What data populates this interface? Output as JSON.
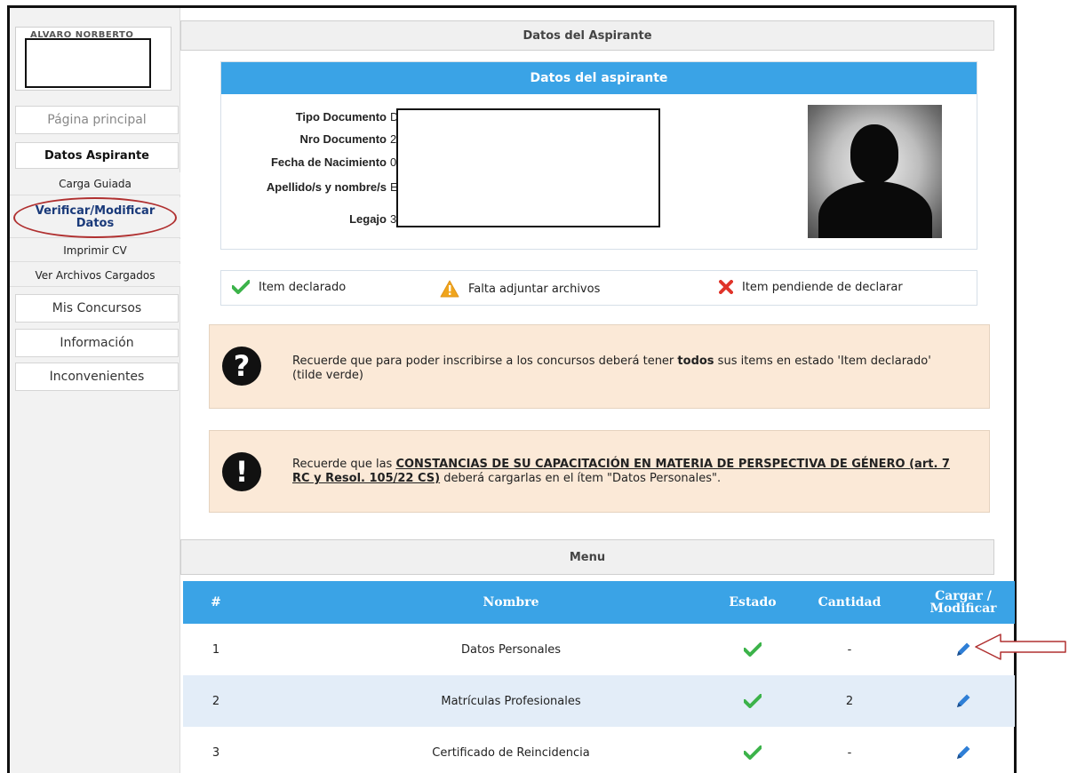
{
  "sidebar": {
    "user_box_text": "ALVARO NORBERTO",
    "nav": [
      {
        "label": "Página principal"
      },
      {
        "label": "Datos Aspirante"
      },
      {
        "label": "Carga Guiada"
      },
      {
        "label": "Verificar/Modificar Datos"
      },
      {
        "label": "Imprimir CV"
      },
      {
        "label": "Ver Archivos Cargados"
      },
      {
        "label": "Mis Concursos"
      },
      {
        "label": "Información"
      },
      {
        "label": "Inconvenientes"
      }
    ]
  },
  "header": {
    "title": "Datos del Aspirante"
  },
  "applicant": {
    "bar_title": "Datos del aspirante",
    "fields": [
      {
        "label": "Tipo Documento",
        "peek": "D"
      },
      {
        "label": "Nro Documento",
        "peek": "2"
      },
      {
        "label": "Fecha de Nacimiento",
        "peek": "0"
      },
      {
        "label": "Apellido/s y nombre/s",
        "peek": "E"
      },
      {
        "label": "Legajo",
        "peek": "3"
      }
    ]
  },
  "legend": {
    "declared": "Item declarado",
    "missing_files": "Falta adjuntar archivos",
    "pending": "Item pendiende de declarar",
    "colors": {
      "declared": "#3cb34a",
      "missing_files": "#f0a51c",
      "pending": "#e0342a"
    }
  },
  "notices": [
    {
      "icon": "?",
      "text_before": "Recuerde que para poder inscribirse a los concursos deberá tener ",
      "text_bold": "todos",
      "text_after": " sus items en estado 'Item declarado' (tilde verde)"
    },
    {
      "icon": "!",
      "text_before": "Recuerde que las ",
      "text_underlined": "CONSTANCIAS DE SU CAPACITACIÓN EN MATERIA DE PERSPECTIVA DE GÉNERO (art. 7 RC y Resol. 105/22 CS)",
      "text_after": " deberá cargarlas en el ítem \"Datos Personales\"."
    }
  ],
  "menu": {
    "title": "Menu",
    "columns": {
      "num": "#",
      "name": "Nombre",
      "status": "Estado",
      "count": "Cantidad",
      "edit_line1": "Cargar /",
      "edit_line2": "Modificar"
    },
    "rows": [
      {
        "num": "1",
        "name": "Datos Personales",
        "status": "declared",
        "count": "-"
      },
      {
        "num": "2",
        "name": "Matrículas Profesionales",
        "status": "declared",
        "count": "2"
      },
      {
        "num": "3",
        "name": "Certificado de Reincidencia",
        "status": "declared",
        "count": "-"
      }
    ]
  },
  "accent_color": "#3aa3e6"
}
